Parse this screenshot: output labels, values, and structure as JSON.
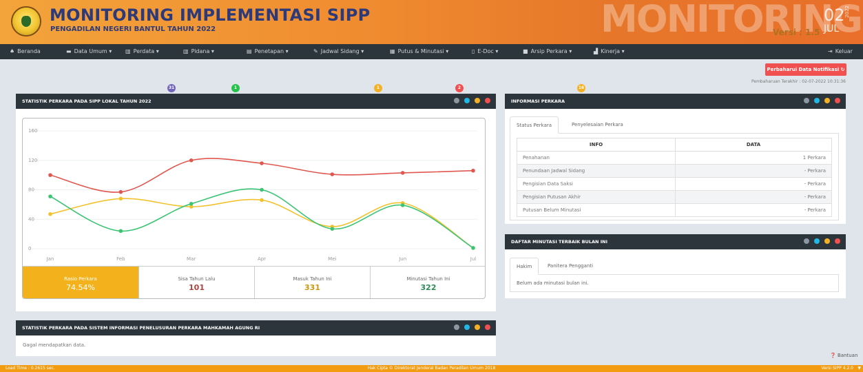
{
  "header": {
    "title": "MONITORING IMPLEMENTASI SIPP",
    "subtitle": "PENGADILAN NEGERI BANTUL TAHUN 2022",
    "watermark": "MONITORING",
    "version": "Versi : 1.5",
    "date_day": "02",
    "date_month": "JUL",
    "date_year": "2022"
  },
  "nav": {
    "beranda": "Beranda",
    "data_umum": "Data Umum ▾",
    "perdata": "Perdata ▾",
    "perdata_badge": "31",
    "pidana": "Pidana ▾",
    "pidana_badge": "1",
    "penetapan": "Penetapan ▾",
    "jadwal_sidang": "Jadwal Sidang ▾",
    "jadwal_badge": "1",
    "putus_minutasi": "Putus & Minutasi ▾",
    "putus_badge": "2",
    "edoc": "E-Doc ▾",
    "arsip_perkara": "Arsip Perkara ▾",
    "arsip_badge": "16",
    "kinerja": "Kinerja ▾",
    "keluar": "Keluar"
  },
  "colors": {
    "badge_purple": "#7266ba",
    "badge_green": "#27c24c",
    "badge_yellow": "#fad733",
    "badge_red": "#f05050",
    "badge_orange": "#f5b125",
    "series_red": "#e0574f",
    "series_yellow": "#f2c22e",
    "series_green": "#3cc474"
  },
  "refresh": {
    "label": "Perbaharui Data Notifikasi ↻",
    "last_update": "Pembaharuan Terakhir : 02-07-2022 10:31:36"
  },
  "panel_stats": {
    "title": "STATISTIK PERKARA PADA SIPP LOKAL TAHUN 2022",
    "stats": [
      {
        "label": "Rasio Perkara",
        "value": "74.54%"
      },
      {
        "label": "Sisa Tahun Lalu",
        "value": "101"
      },
      {
        "label": "Masuk Tahun Ini",
        "value": "331"
      },
      {
        "label": "Minutasi Tahun Ini",
        "value": "322"
      }
    ]
  },
  "chart_data": {
    "type": "line",
    "categories": [
      "Jan",
      "Feb",
      "Mar",
      "Apr",
      "Mei",
      "Jun",
      "Jul"
    ],
    "ylim": [
      0,
      160
    ],
    "yticks": [
      "0",
      "40",
      "80",
      "120",
      "160"
    ],
    "grid": true,
    "smooth": true,
    "series": [
      {
        "color": "#e0574f",
        "values": [
          100,
          77,
          120,
          116,
          101,
          103,
          106
        ]
      },
      {
        "color": "#f2c22e",
        "values": [
          47,
          68,
          57,
          66,
          30,
          62,
          1
        ]
      },
      {
        "color": "#3cc474",
        "values": [
          71,
          24,
          61,
          80,
          27,
          59,
          1
        ]
      }
    ]
  },
  "panel_info": {
    "title": "INFORMASI PERKARA",
    "tabs": [
      "Status Perkara",
      "Penyelesaian Perkara"
    ],
    "columns": [
      "INFO",
      "DATA"
    ],
    "rows": [
      {
        "info": "Penahanan",
        "data": "1 Perkara"
      },
      {
        "info": "Penundaan Jadwal Sidang",
        "data": "- Perkara"
      },
      {
        "info": "Pengisian Data Saksi",
        "data": "- Perkara"
      },
      {
        "info": "Pengisian Putusan Akhir",
        "data": "- Perkara"
      },
      {
        "info": "Putusan Belum Minutasi",
        "data": "- Perkara"
      }
    ]
  },
  "panel_minutasi": {
    "title": "DAFTAR MINUTASI TERBAIK BULAN INI",
    "tabs": [
      "Hakim",
      "Panitera Pengganti"
    ],
    "empty": "Belum ada minutasi bulan ini."
  },
  "panel_ma": {
    "title": "STATISTIK PERKARA PADA SISTEM INFORMASI PENELUSURAN PERKARA MAHKAMAH AGUNG RI",
    "message": "Gagal mendapatkan data."
  },
  "bantuan": "Bantuan",
  "footer": {
    "load_time": "Load Time : 0.2615 sec.",
    "copyright": "Hak Cipta © Direktorat Jenderal Badan Peradilan Umum 2018",
    "version": "Versi SIPP 4.2.0"
  }
}
